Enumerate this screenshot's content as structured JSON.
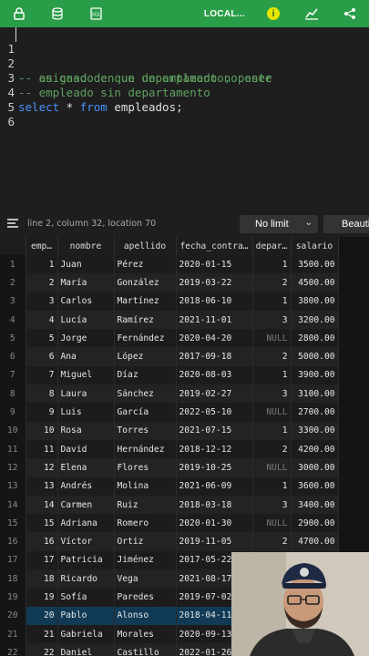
{
  "toolbar": {
    "icons": [
      "lock-icon",
      "database-icon",
      "sql-file-icon",
      "info-icon",
      "chart-icon",
      "share-icon"
    ],
    "connection_label": "LOCAL...",
    "warning_symbol": "i",
    "accent_color": "#2a9d48"
  },
  "editor": {
    "lines": [
      {
        "num": "1",
        "text": "-- en caso de que un empleado no este",
        "kind": "comment"
      },
      {
        "num": "2",
        "text": "-- asignado en un departamento, poner",
        "kind": "comment"
      },
      {
        "num": "3",
        "text": "-- empleado sin departamento",
        "kind": "comment"
      },
      {
        "num": "4",
        "kw1": "select",
        "mid": " * ",
        "kw2": "from",
        "rest": " empleados;",
        "kind": "sql"
      },
      {
        "num": "5",
        "text": "",
        "kind": "empty"
      },
      {
        "num": "6",
        "text": "",
        "kind": "empty"
      }
    ]
  },
  "status": {
    "position_text": "line 2, column 32, location 70",
    "limit_value": "No limit",
    "beautify_label": "Beauti"
  },
  "results": {
    "columns": [
      "emp…",
      "nombre",
      "apellido",
      "fecha_contra…",
      "depar…",
      "salario"
    ],
    "null_label": "NULL",
    "rows": [
      [
        "1",
        "1",
        "Juan",
        "Pérez",
        "2020-01-15",
        "1",
        "3500.00"
      ],
      [
        "2",
        "2",
        "María",
        "González",
        "2019-03-22",
        "2",
        "4500.00"
      ],
      [
        "3",
        "3",
        "Carlos",
        "Martínez",
        "2018-06-10",
        "1",
        "3800.00"
      ],
      [
        "4",
        "4",
        "Lucía",
        "Ramírez",
        "2021-11-01",
        "3",
        "3200.00"
      ],
      [
        "5",
        "5",
        "Jorge",
        "Fernández",
        "2020-04-20",
        "NULL",
        "2800.00"
      ],
      [
        "6",
        "6",
        "Ana",
        "López",
        "2017-09-18",
        "2",
        "5000.00"
      ],
      [
        "7",
        "7",
        "Miguel",
        "Díaz",
        "2020-08-03",
        "1",
        "3900.00"
      ],
      [
        "8",
        "8",
        "Laura",
        "Sánchez",
        "2019-02-27",
        "3",
        "3100.00"
      ],
      [
        "9",
        "9",
        "Luis",
        "García",
        "2022-05-10",
        "NULL",
        "2700.00"
      ],
      [
        "10",
        "10",
        "Rosa",
        "Torres",
        "2021-07-15",
        "1",
        "3300.00"
      ],
      [
        "11",
        "11",
        "David",
        "Hernández",
        "2018-12-12",
        "2",
        "4200.00"
      ],
      [
        "12",
        "12",
        "Elena",
        "Flores",
        "2019-10-25",
        "NULL",
        "3000.00"
      ],
      [
        "13",
        "13",
        "Andrés",
        "Molina",
        "2021-06-09",
        "1",
        "3600.00"
      ],
      [
        "14",
        "14",
        "Carmen",
        "Ruiz",
        "2018-03-18",
        "3",
        "3400.00"
      ],
      [
        "15",
        "15",
        "Adriana",
        "Romero",
        "2020-01-30",
        "NULL",
        "2900.00"
      ],
      [
        "16",
        "16",
        "Víctor",
        "Ortiz",
        "2019-11-05",
        "2",
        "4700.00"
      ],
      [
        "17",
        "17",
        "Patricia",
        "Jiménez",
        "2017-05-22",
        "",
        ""
      ],
      [
        "18",
        "18",
        "Ricardo",
        "Vega",
        "2021-08-17",
        "",
        ""
      ],
      [
        "19",
        "19",
        "Sofía",
        "Paredes",
        "2019-07-02",
        "",
        ""
      ],
      [
        "20",
        "20",
        "Pablo",
        "Alonso",
        "2018-04-11",
        "",
        ""
      ],
      [
        "21",
        "21",
        "Gabriela",
        "Morales",
        "2020-09-13",
        "",
        ""
      ],
      [
        "22",
        "22",
        "Daniel",
        "Castillo",
        "2022-01-26",
        "",
        ""
      ]
    ],
    "selected_row": 20
  }
}
